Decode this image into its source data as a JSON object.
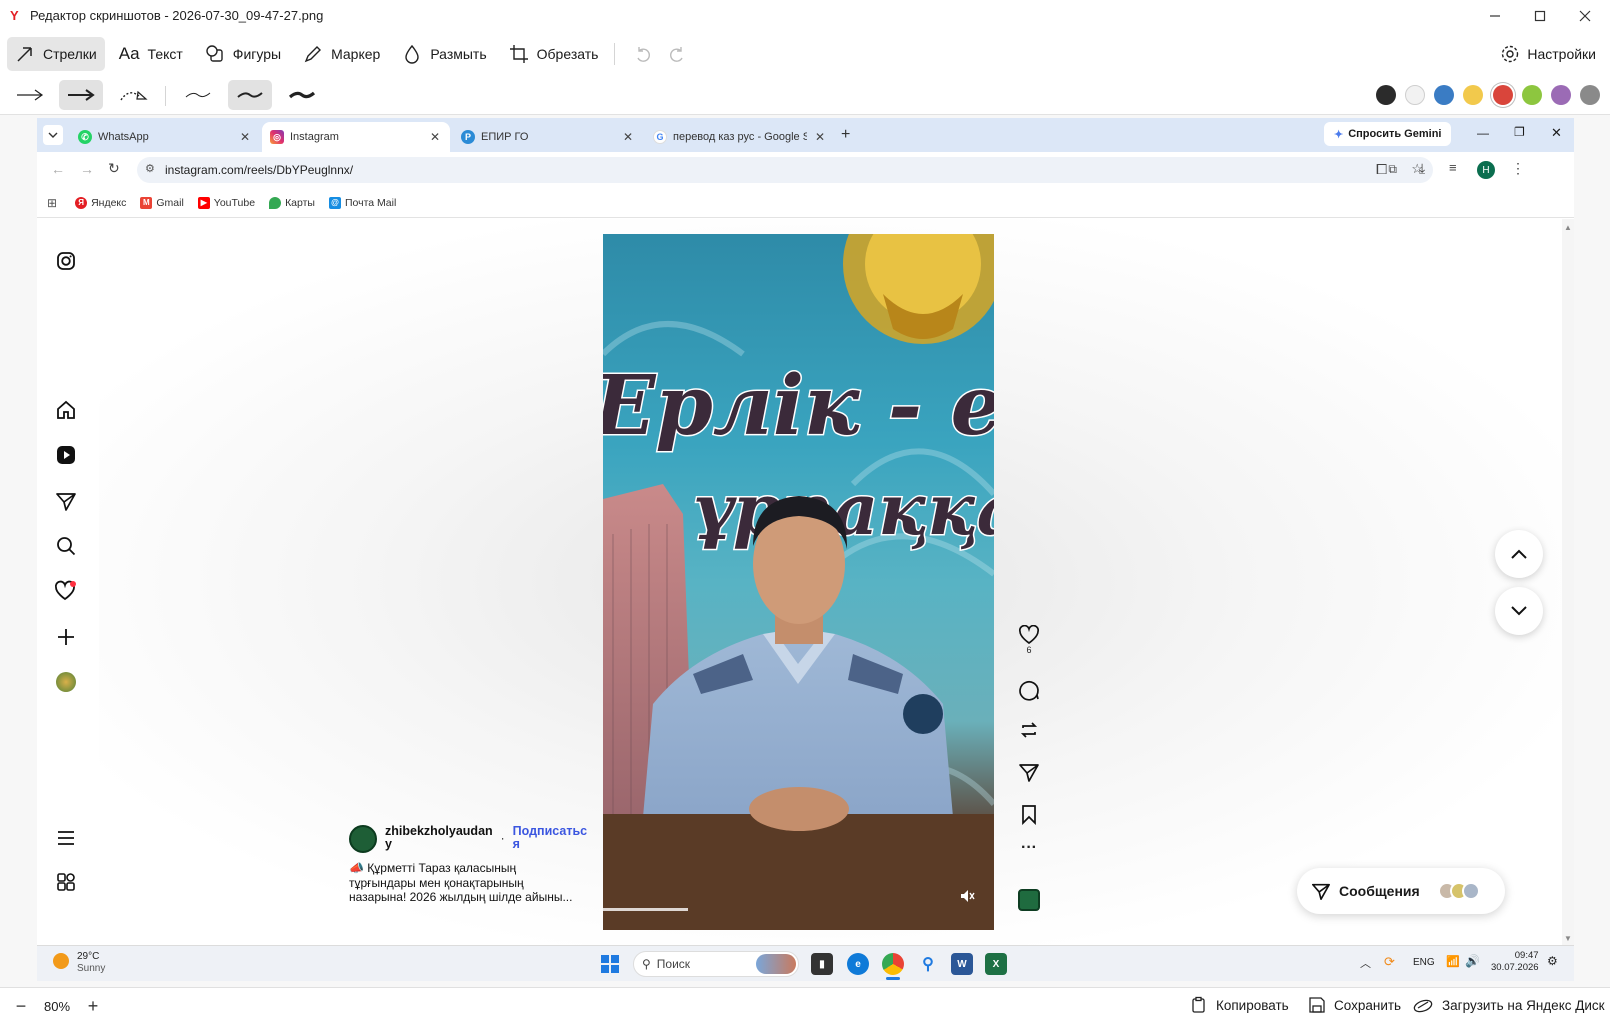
{
  "app": {
    "title": "Редактор скриншотов - 2026-07-30_09-47-27.png"
  },
  "toolbar": {
    "tools": [
      "Стрелки",
      "Текст",
      "Фигуры",
      "Маркер",
      "Размыть",
      "Обрезать"
    ],
    "settings_label": "Настройки",
    "active_tool": "Стрелки"
  },
  "colors": {
    "palette": [
      "#2b2b2b",
      "#f2f2f2",
      "#3a7cc4",
      "#f2c94c",
      "#d9453b",
      "#8dc63f",
      "#9b6bb5",
      "#8a8a8a"
    ],
    "selected": "#d9453b"
  },
  "browser": {
    "tabs": [
      {
        "label": "WhatsApp",
        "icon": "whatsapp-icon"
      },
      {
        "label": "Instagram",
        "icon": "instagram-icon",
        "active": true
      },
      {
        "label": "ЕПИР ГО",
        "icon": "epir-icon"
      },
      {
        "label": "перевод каз рус - Google Search",
        "icon": "google-icon"
      }
    ],
    "gemini_label": "Спросить Gemini",
    "url": "instagram.com/reels/DbYPeuglnnx/",
    "profile_initial": "H",
    "bookmarks": [
      "Яндекс",
      "Gmail",
      "YouTube",
      "Карты",
      "Почта Mail"
    ]
  },
  "reel": {
    "likes": "6",
    "username_line1": "zhibekzholyaudan",
    "username_line2": "у",
    "follow_line1": "Подписатьс",
    "follow_line2": "я",
    "caption_lines": [
      "📣 Құрметті Тараз қаласының",
      "тұрғындары мен қонақтарының",
      "назарына! 2026 жылдың шілде айыны..."
    ],
    "banner_text_1": "Ерлік - ел",
    "banner_text_2": "ұрпаққа -"
  },
  "messages": {
    "label": "Сообщения"
  },
  "taskbar": {
    "weather_temp": "29°C",
    "weather_desc": "Sunny",
    "search_placeholder": "Поиск",
    "lang": "ENG",
    "time": "09:47",
    "date": "30.07.2026"
  },
  "bottom": {
    "zoom": "80%",
    "copy_label": "Копировать",
    "save_label": "Сохранить",
    "upload_label": "Загрузить на Яндекс Диск"
  }
}
